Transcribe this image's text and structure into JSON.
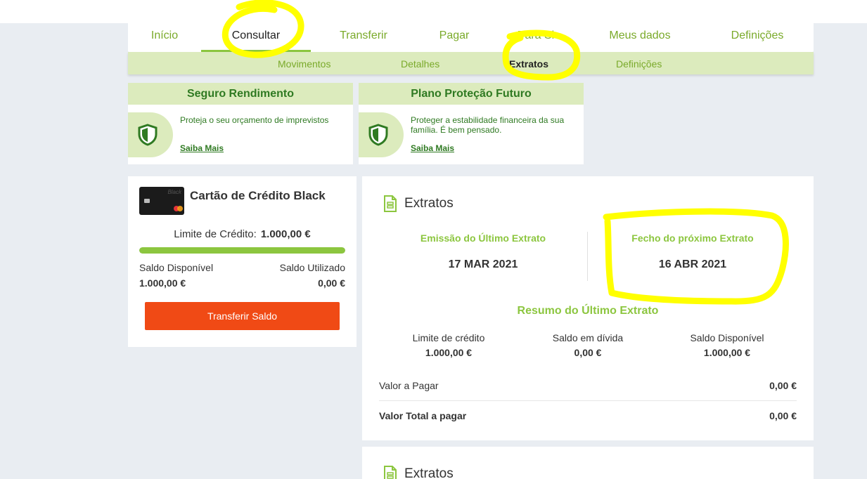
{
  "nav": {
    "items": [
      {
        "label": "Início",
        "active": false
      },
      {
        "label": "Consultar",
        "active": true
      },
      {
        "label": "Transferir",
        "active": false
      },
      {
        "label": "Pagar",
        "active": false
      },
      {
        "label": "Para Si",
        "active": false
      },
      {
        "label": "Meus dados",
        "active": false
      },
      {
        "label": "Definições",
        "active": false
      }
    ]
  },
  "subnav": {
    "items": [
      {
        "label": "Movimentos",
        "active": false
      },
      {
        "label": "Detalhes",
        "active": false
      },
      {
        "label": "Extratos",
        "active": true
      },
      {
        "label": "Definições",
        "active": false
      }
    ]
  },
  "promos": [
    {
      "title": "Seguro Rendimento",
      "text": "Proteja o seu orçamento de imprevistos",
      "link": "Saiba Mais",
      "icon": "shield-icon"
    },
    {
      "title": "Plano Proteção Futuro",
      "text": "Proteger a estabilidade financeira da sua família. É bem pensado.",
      "link": "Saiba Mais",
      "icon": "shield-icon"
    }
  ],
  "card": {
    "title": "Cartão de Crédito Black",
    "card_brand_text": "Black",
    "limit_label": "Limite de Crédito:",
    "limit_value": "1.000,00 €",
    "used_fraction": 0,
    "available_label": "Saldo Disponível",
    "available_value": "1.000,00 €",
    "used_label": "Saldo Utilizado",
    "used_value": "0,00 €",
    "transfer_button": "Transferir Saldo"
  },
  "extratos": {
    "title": "Extratos",
    "last_issue_label": "Emissão do Último Extrato",
    "last_issue_value": "17 MAR 2021",
    "next_close_label": "Fecho do próximo Extrato",
    "next_close_value": "16 ABR 2021",
    "summary_title": "Resumo do Último Extrato",
    "summary": [
      {
        "label": "Limite de crédito",
        "value": "1.000,00 €"
      },
      {
        "label": "Saldo em dívida",
        "value": "0,00 €"
      },
      {
        "label": "Saldo Disponível",
        "value": "1.000,00 €"
      }
    ],
    "amount_due_label": "Valor a Pagar",
    "amount_due_value": "0,00 €",
    "total_due_label": "Valor Total a pagar",
    "total_due_value": "0,00 €"
  },
  "extratos_second": {
    "title": "Extratos"
  },
  "colors": {
    "accent": "#8cc63f",
    "dark_green": "#2f7a22",
    "light_green": "#dcebbd",
    "button": "#f04a15",
    "highlight": "#ffff00"
  }
}
